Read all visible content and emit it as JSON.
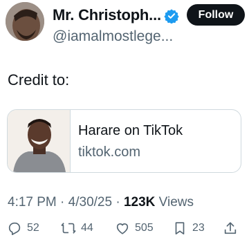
{
  "author": {
    "display_name": "Mr. Christoph...",
    "handle": "@iamalmostlege...",
    "follow_label": "Follow"
  },
  "tweet": {
    "text": "Credit to:"
  },
  "link_card": {
    "title": "Harare on TikTok",
    "domain": "tiktok.com"
  },
  "meta": {
    "time": "4:17 PM",
    "separator_1": " · ",
    "date": "4/30/25",
    "separator_2": " · ",
    "views_count": "123K",
    "views_label": " Views"
  },
  "actions": {
    "replies": "52",
    "reposts": "44",
    "likes": "505",
    "bookmarks": "23"
  },
  "colors": {
    "text_primary": "#0f1419",
    "text_secondary": "#536471",
    "verified_blue": "#1d9bf0",
    "border": "#cfd9de"
  },
  "icons": [
    "verified-badge-icon",
    "reply-icon",
    "repost-icon",
    "like-icon",
    "bookmark-icon",
    "share-icon"
  ]
}
